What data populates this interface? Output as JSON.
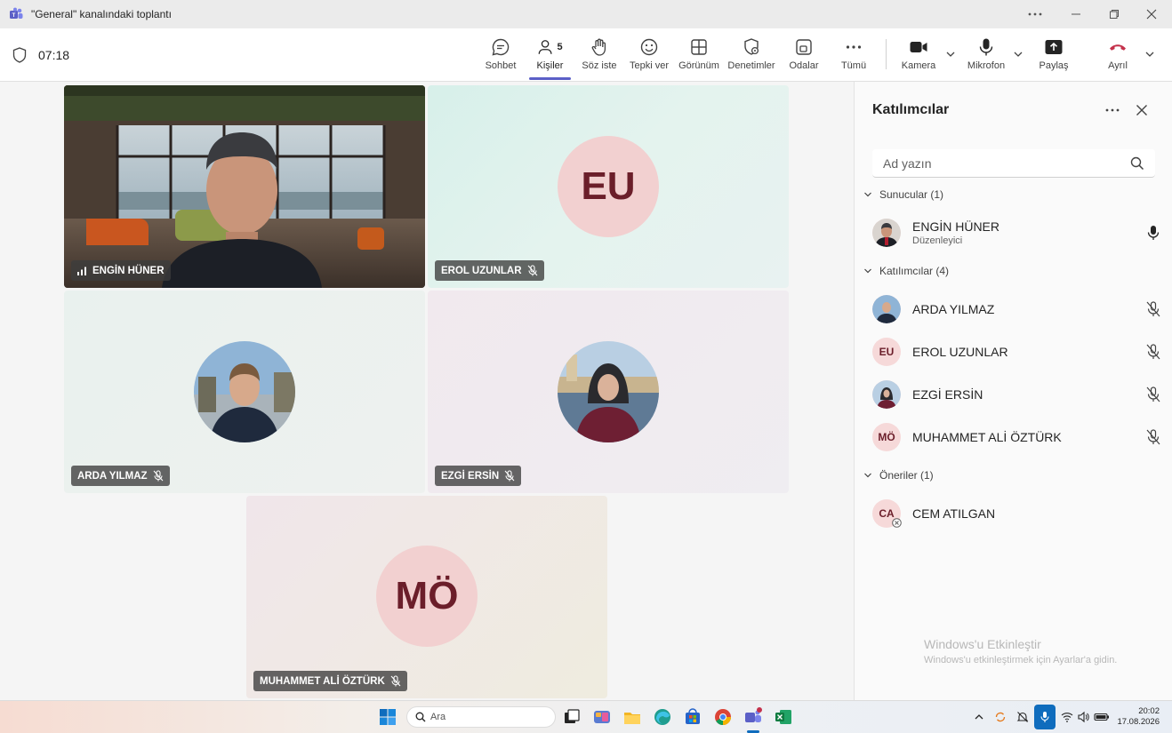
{
  "window": {
    "title": "\"General\" kanalındaki toplantı"
  },
  "toolbar": {
    "timer": "07:18",
    "buttons": [
      {
        "label": "Sohbet",
        "icon": "chat-icon"
      },
      {
        "label": "Kişiler",
        "icon": "people-icon",
        "badge": "5"
      },
      {
        "label": "Söz iste",
        "icon": "raise-hand-icon"
      },
      {
        "label": "Tepki ver",
        "icon": "smiley-icon"
      },
      {
        "label": "Görünüm",
        "icon": "grid-view-icon"
      },
      {
        "label": "Denetimler",
        "icon": "shield-gear-icon"
      },
      {
        "label": "Odalar",
        "icon": "rooms-icon"
      },
      {
        "label": "Tümü",
        "icon": "more-icon"
      },
      {
        "label": "Kamera",
        "icon": "camera-icon"
      },
      {
        "label": "Mikrofon",
        "icon": "microphone-icon"
      },
      {
        "label": "Paylaş",
        "icon": "share-icon"
      },
      {
        "label": "Ayrıl",
        "icon": "hang-up-icon"
      }
    ]
  },
  "tiles": [
    {
      "name": "ENGİN HÜNER",
      "type": "video"
    },
    {
      "name": "EROL UZUNLAR",
      "initials": "EU",
      "muted": true
    },
    {
      "name": "ARDA YILMAZ",
      "type": "photo",
      "muted": true
    },
    {
      "name": "EZGİ ERSİN",
      "type": "photo",
      "muted": true
    },
    {
      "name": "MUHAMMET ALİ ÖZTÜRK",
      "initials": "MÖ",
      "muted": true
    }
  ],
  "panel": {
    "title": "Katılımcılar",
    "search_placeholder": "Ad yazın",
    "sections": {
      "presenters": "Sunucular (1)",
      "attendees": "Katılımcılar (4)",
      "suggestions": "Öneriler (1)"
    },
    "presenters": [
      {
        "name": "ENGİN HÜNER",
        "role": "Düzenleyici"
      }
    ],
    "attendees": [
      {
        "name": "ARDA YILMAZ"
      },
      {
        "name": "EROL UZUNLAR",
        "initials": "EU"
      },
      {
        "name": "EZGİ ERSİN"
      },
      {
        "name": "MUHAMMET ALİ ÖZTÜRK",
        "initials": "MÖ"
      }
    ],
    "suggestions": [
      {
        "name": "CEM ATILGAN",
        "initials": "CA"
      }
    ]
  },
  "activation": {
    "title": "Windows'u Etkinleştir",
    "subtitle": "Windows'u etkinleştirmek için Ayarlar'a gidin."
  },
  "taskbar": {
    "search_placeholder": "Ara",
    "time": "20:02",
    "date": "17.08.2026"
  },
  "colors": {
    "accent": "#5b5fc7",
    "hangup": "#c4314b",
    "avatar_bg": "#f2d0d0",
    "avatar_text": "#6b1e2a"
  }
}
